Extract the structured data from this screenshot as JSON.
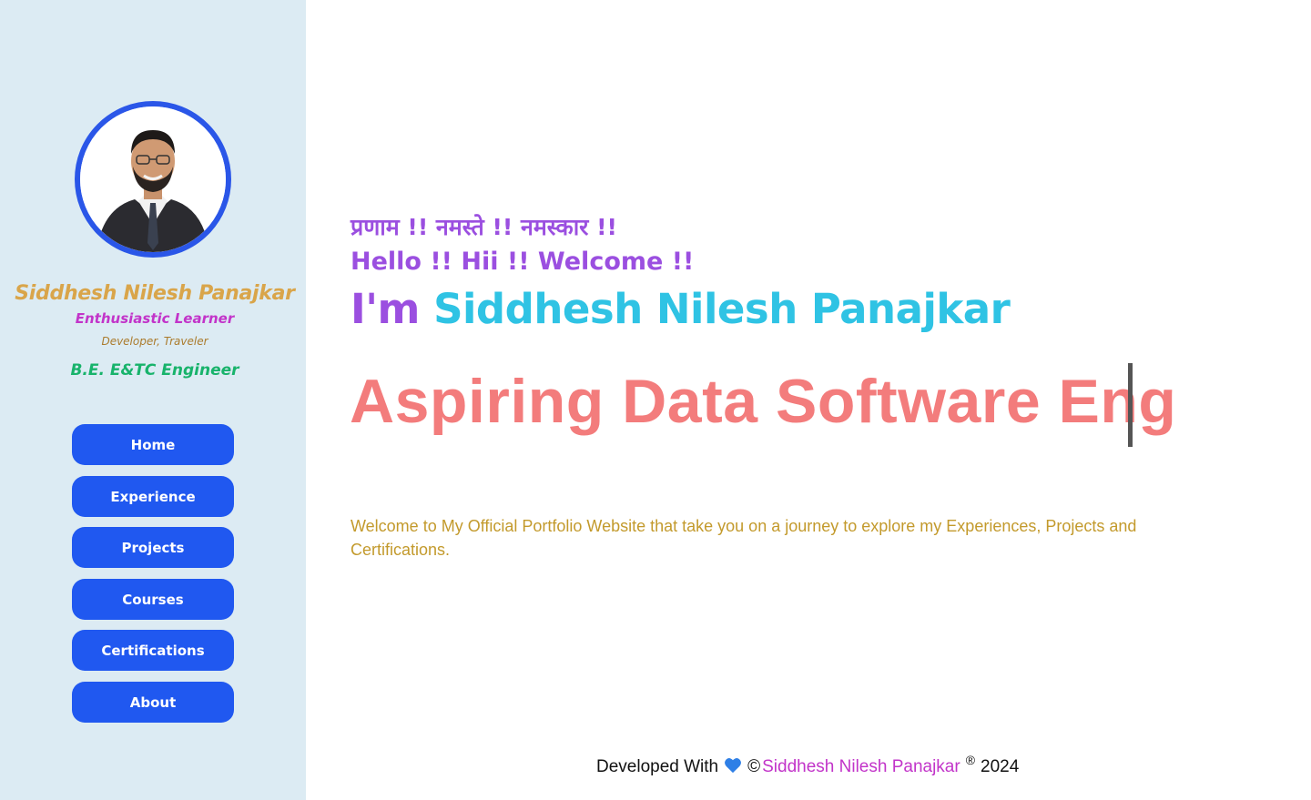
{
  "sidebar": {
    "avatar_alt": "Siddhesh Nilesh Panajkar",
    "name": "Siddhesh Nilesh Panajkar",
    "tagline": "Enthusiastic Learner",
    "subtitle": "Developer, Traveler",
    "degree": "B.E. E&TC Engineer",
    "nav": [
      {
        "label": "Home"
      },
      {
        "label": "Experience"
      },
      {
        "label": "Projects"
      },
      {
        "label": "Courses"
      },
      {
        "label": "Certifications"
      },
      {
        "label": "About"
      }
    ]
  },
  "main": {
    "greeting_hindi": "प्रणाम !! नमस्ते !! नमस्कार !!",
    "greeting_en": "Hello !! Hii !! Welcome !!",
    "intro_prefix": "I'm",
    "intro_name": "Siddhesh Nilesh Panajkar",
    "headline": "Aspiring Data Software Eng",
    "welcome": "Welcome to My Official Portfolio Website that take you on a journey to explore my Experiences, Projects and Certifications."
  },
  "footer": {
    "prefix": "Developed With",
    "heart_icon": "blue-heart-icon",
    "copyright": "©",
    "author": "Siddhesh Nilesh Panajkar",
    "registered": "®",
    "year": "2024"
  },
  "colors": {
    "sidebar_bg": "#dcebf3",
    "nav_button": "#2058f0",
    "avatar_border": "#2a56e8",
    "name_gold": "#d9a54a",
    "purple": "#9b4fe0",
    "cyan": "#2fc3e4",
    "headline_coral": "#f37c7c",
    "welcome_text": "#c39a2c",
    "magenta": "#c234c9",
    "degree_green": "#18b36b"
  }
}
